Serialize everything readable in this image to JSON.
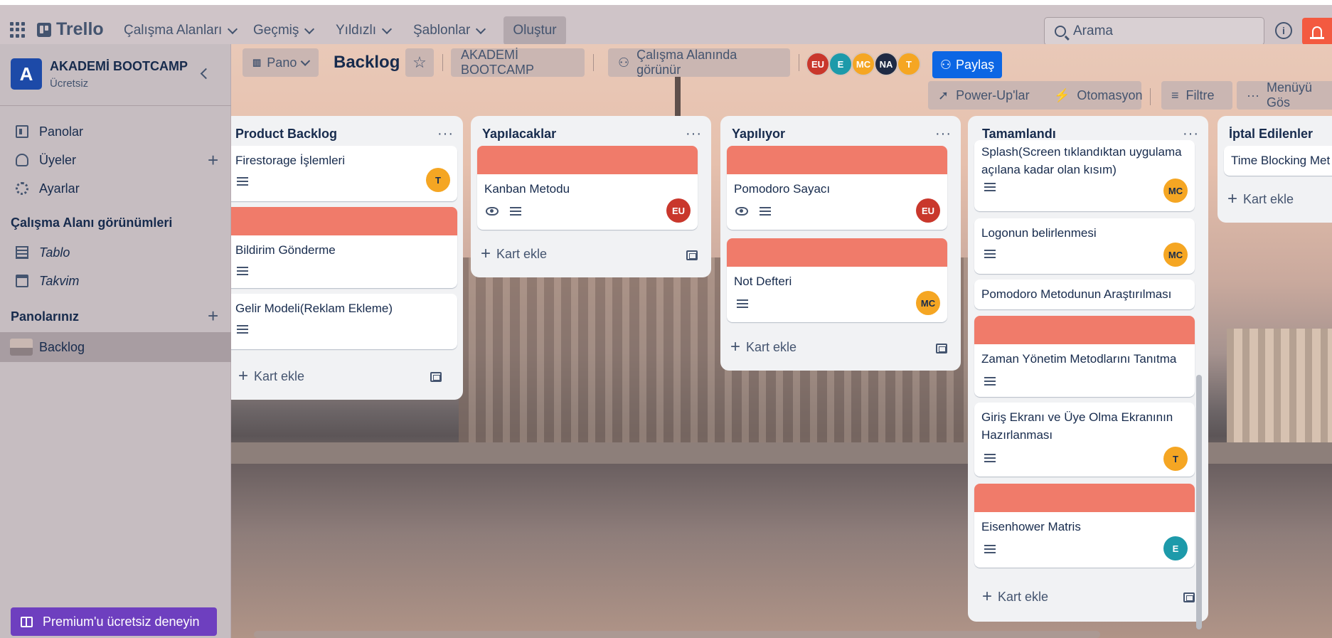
{
  "topbar": {
    "logo": "Trello",
    "nav": [
      "Çalışma Alanları",
      "Geçmiş",
      "Yıldızlı",
      "Şablonlar"
    ],
    "create": "Oluştur",
    "search_placeholder": "Arama"
  },
  "sidebar": {
    "workspace_initial": "A",
    "workspace_name": "AKADEMİ BOOTCAMP",
    "workspace_plan": "Ücretsiz",
    "items": [
      {
        "label": "Panolar",
        "icon": "board-icon"
      },
      {
        "label": "Üyeler",
        "icon": "user-icon"
      },
      {
        "label": "Ayarlar",
        "icon": "gear-icon"
      }
    ],
    "views_heading": "Çalışma Alanı görünümleri",
    "views": [
      {
        "label": "Tablo",
        "icon": "table-icon"
      },
      {
        "label": "Takvim",
        "icon": "calendar-icon"
      }
    ],
    "boards_heading": "Panolarınız",
    "boards": [
      {
        "label": "Backlog"
      }
    ],
    "premium": "Premium'u ücretsiz deneyin"
  },
  "board": {
    "view_switch": "Pano",
    "title": "Backlog",
    "workspace_chip": "AKADEMİ BOOTCAMP",
    "visibility": "Çalışma Alanında görünür",
    "members": [
      {
        "initials": "EU",
        "color": "#c9372c"
      },
      {
        "initials": "E",
        "color": "#1d9aaa"
      },
      {
        "initials": "MC",
        "color": "#f5a623"
      },
      {
        "initials": "NA",
        "color": "#1f2a44"
      },
      {
        "initials": "T",
        "color": "#f5a623"
      }
    ],
    "share": "Paylaş",
    "powerups": "Power-Up'lar",
    "automation": "Otomasyon",
    "filter": "Filtre",
    "menu": "Menüyü Gös"
  },
  "lists": [
    {
      "title": "Product Backlog",
      "add_card": "Kart ekle",
      "cards": [
        {
          "title": "Firestorage İşlemleri",
          "avatar": "T"
        },
        {
          "title": "Bildirim Gönderme",
          "cover": true
        },
        {
          "title": "Gelir Modeli(Reklam Ekleme)"
        }
      ]
    },
    {
      "title": "Yapılacaklar",
      "add_card": "Kart ekle",
      "cards": [
        {
          "title": "Kanban Metodu",
          "cover": true,
          "avatar": "EU"
        }
      ]
    },
    {
      "title": "Yapılıyor",
      "add_card": "Kart ekle",
      "cards": [
        {
          "title": "Pomodoro Sayacı",
          "cover": true,
          "avatar": "EU"
        },
        {
          "title": "Not Defteri",
          "cover": true,
          "avatar": "MC"
        }
      ]
    },
    {
      "title": "Tamamlandı",
      "add_card": "Kart ekle",
      "cards": [
        {
          "title": "Splash(Screen tıklandıktan uygulama açılana kadar olan kısım)",
          "avatar": "MC"
        },
        {
          "title": "Logonun belirlenmesi",
          "avatar": "MC"
        },
        {
          "title": "Pomodoro Metodunun Araştırılması"
        },
        {
          "title": "Zaman Yönetim Metodlarını Tanıtma",
          "cover": true
        },
        {
          "title": "Giriş Ekranı ve Üye Olma Ekranının Hazırlanması",
          "avatar": "T"
        },
        {
          "title": "Eisenhower Matris",
          "cover": true,
          "avatar": "E"
        }
      ]
    },
    {
      "title": "İptal Edilenler",
      "add_card": "Kart ekle",
      "cards": [
        {
          "title": "Time Blocking Met"
        }
      ]
    }
  ]
}
